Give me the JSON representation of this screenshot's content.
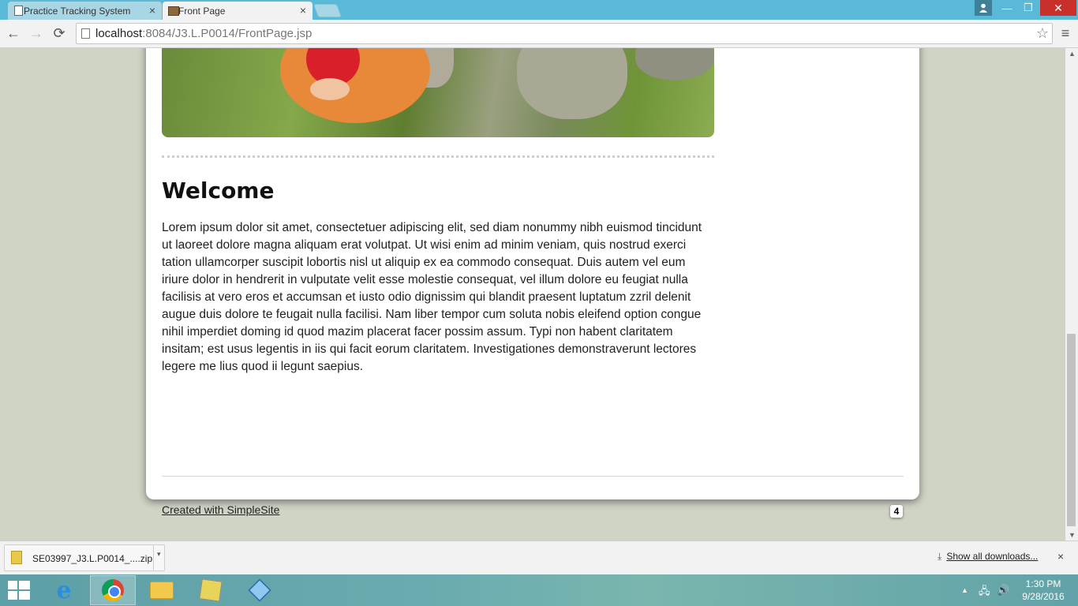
{
  "browser": {
    "tabs": [
      {
        "title": "Practice Tracking System",
        "close": "×"
      },
      {
        "title": "Front Page",
        "close": "×"
      }
    ],
    "window_controls": {
      "min": "—",
      "max": "❐",
      "close": "✕"
    },
    "nav": {
      "back": "←",
      "forward": "→",
      "reload": "⟳",
      "menu": "≡",
      "star": "☆"
    },
    "url_host": "localhost",
    "url_path": ":8084/J3.L.P0014/FrontPage.jsp"
  },
  "page": {
    "heading": "Welcome",
    "body": "Lorem ipsum dolor sit amet, consectetuer adipiscing elit, sed diam nonummy nibh euismod tincidunt ut laoreet dolore magna aliquam erat volutpat. Ut wisi enim ad minim veniam, quis nostrud exerci tation ullamcorper suscipit lobortis nisl ut aliquip ex ea commodo consequat. Duis autem vel eum iriure dolor in hendrerit in vulputate velit esse molestie consequat, vel illum dolore eu feugiat nulla facilisis at vero eros et accumsan et iusto odio dignissim qui blandit praesent luptatum zzril delenit augue duis dolore te feugait nulla facilisi. Nam liber tempor cum soluta nobis eleifend option congue nihil imperdiet doming id quod mazim placerat facer possim assum. Typi non habent claritatem insitam; est usus legentis in iis qui facit eorum claritatem. Investigationes demonstraverunt lectores legere me lius quod ii legunt saepius.",
    "footer_link": "Created with SimpleSite",
    "page_count": "4"
  },
  "downloads": {
    "file": "SE03997_J3.L.P0014_....zip",
    "caret": "▾",
    "show_all": "Show all downloads...",
    "close": "×"
  },
  "taskbar": {
    "time": "1:30 PM",
    "date": "9/28/2016",
    "tray_arrow": "▲",
    "network": "🖧",
    "volume": "🔊",
    "ie": "e"
  },
  "colors": {
    "tabbar": "#5ab9d6",
    "page_bg": "#cfd4c5",
    "close_button": "#c9302c"
  }
}
